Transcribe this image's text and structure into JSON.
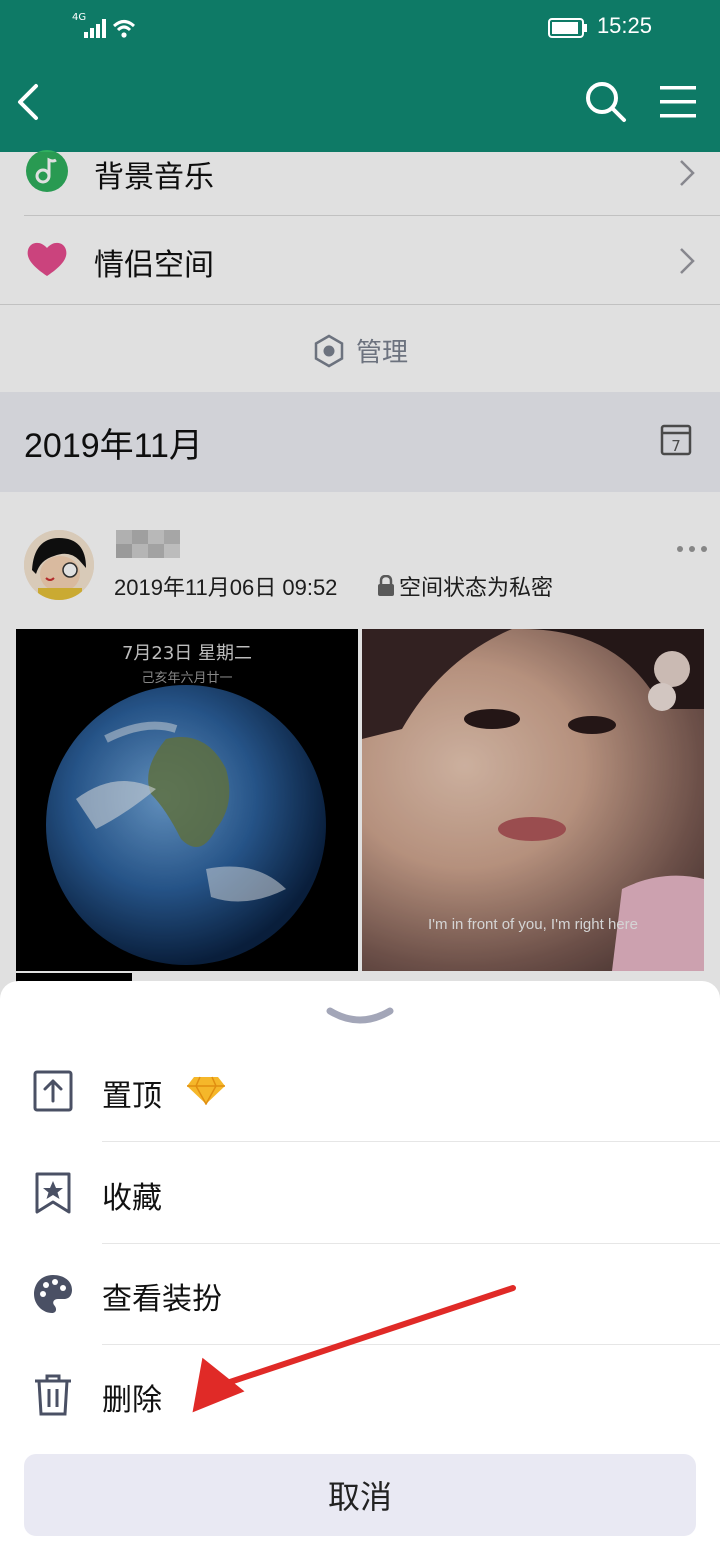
{
  "status_bar": {
    "network": "4G",
    "time": "15:25"
  },
  "nav": {
    "back_icon": "chevron-left-icon",
    "search_icon": "search-icon",
    "menu_icon": "hamburger-menu-icon"
  },
  "list": {
    "items": [
      {
        "label": "背景音乐",
        "icon": "music-note-icon"
      },
      {
        "label": "情侣空间",
        "icon": "heart-icon"
      }
    ],
    "manage_label": "管理"
  },
  "section": {
    "month": "2019年11月",
    "calendar_day": "7"
  },
  "post": {
    "time": "2019年11月06日 09:52",
    "privacy": "空间状态为私密",
    "photo1_date": "7月23日 星期二",
    "photo1_lunar": "己亥年六月廿一",
    "photo2_caption": "I'm in front of you, I'm right here"
  },
  "sheet": {
    "items": [
      {
        "label": "置顶",
        "icon": "pin-top-icon"
      },
      {
        "label": "收藏",
        "icon": "bookmark-star-icon"
      },
      {
        "label": "查看装扮",
        "icon": "palette-icon"
      },
      {
        "label": "删除",
        "icon": "trash-icon"
      }
    ],
    "cancel": "取消"
  },
  "colors": {
    "brand": "#0e7a66",
    "accent_arrow": "#e02a27",
    "cancel_bg": "#e9e9f3",
    "vip_diamond": "#f5b72a"
  }
}
